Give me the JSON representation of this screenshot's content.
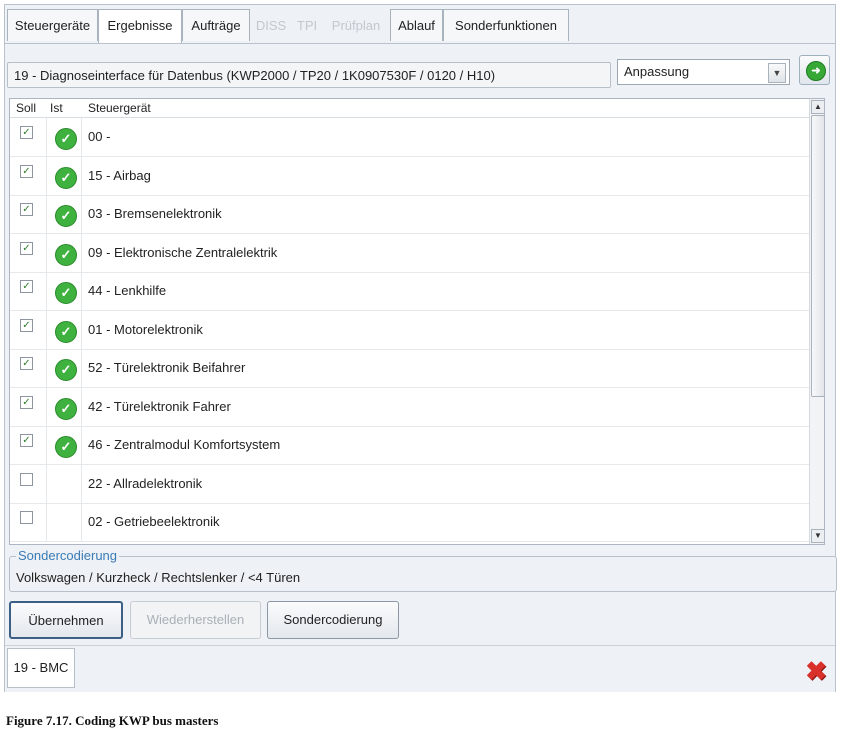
{
  "tabs": [
    {
      "label": "Steuergeräte",
      "state": "normal"
    },
    {
      "label": "Ergebnisse",
      "state": "active"
    },
    {
      "label": "Aufträge",
      "state": "normal"
    },
    {
      "label": "DISS",
      "state": "disabled"
    },
    {
      "label": "TPI",
      "state": "disabled"
    },
    {
      "label": "Prüfplan",
      "state": "disabled"
    },
    {
      "label": "Ablauf",
      "state": "normal"
    },
    {
      "label": "Sonderfunktionen",
      "state": "normal"
    }
  ],
  "header": {
    "module_title": "19 - Diagnoseinterface für Datenbus  (KWP2000 / TP20 / 1K0907530F   / 0120 / H10)",
    "mode_select": "Anpassung"
  },
  "table": {
    "columns": [
      "Soll",
      "Ist",
      "Steuergerät"
    ],
    "rows": [
      {
        "label": "00 -",
        "soll": true,
        "ist": true
      },
      {
        "label": "15 - Airbag",
        "soll": true,
        "ist": true
      },
      {
        "label": "03 - Bremsenelektronik",
        "soll": true,
        "ist": true
      },
      {
        "label": "09 - Elektronische Zentralelektrik",
        "soll": true,
        "ist": true
      },
      {
        "label": "44 - Lenkhilfe",
        "soll": true,
        "ist": true
      },
      {
        "label": "01 - Motorelektronik",
        "soll": true,
        "ist": true
      },
      {
        "label": "52 - Türelektronik Beifahrer",
        "soll": true,
        "ist": true
      },
      {
        "label": "42 - Türelektronik Fahrer",
        "soll": true,
        "ist": true
      },
      {
        "label": "46 - Zentralmodul Komfortsystem",
        "soll": true,
        "ist": true
      },
      {
        "label": "22 - Allradelektronik",
        "soll": false,
        "ist": false
      },
      {
        "label": "02 - Getriebeelektronik",
        "soll": false,
        "ist": false
      }
    ]
  },
  "sondercodierung": {
    "legend": "Sondercodierung",
    "value": "Volkswagen / Kurzheck / Rechtslenker / <4 Türen"
  },
  "buttons": {
    "apply": "Übernehmen",
    "restore": "Wiederherstellen",
    "special": "Sondercodierung"
  },
  "status": {
    "tab_label": "19 - BMC"
  },
  "caption": "Figure 7.17. Coding KWP bus masters",
  "icons": {
    "ok": "green-check-icon",
    "go": "green-arrow-icon",
    "close": "red-x-icon"
  },
  "colors": {
    "ok_green": "#3fb13f",
    "close_red": "#d9302a",
    "legend_blue": "#3a7bb6"
  }
}
